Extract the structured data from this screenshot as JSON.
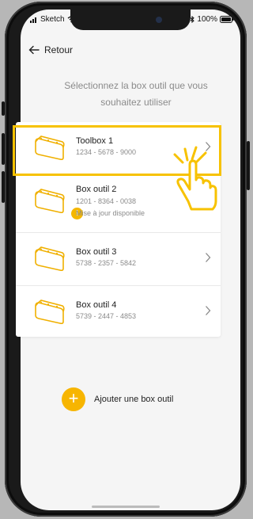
{
  "status": {
    "carrier": "Sketch",
    "battery": "100%"
  },
  "nav": {
    "back_label": "Retour"
  },
  "intro_text": "Sélectionnez la box outil que vous souhaitez utiliser",
  "boxes": [
    {
      "title": "Toolbox 1",
      "code": "1234 - 5678 - 9000",
      "update": ""
    },
    {
      "title": "Box outil 2",
      "code": "1201 - 8364 - 0038",
      "update": "Mise à jour disponible"
    },
    {
      "title": "Box outil 3",
      "code": "5738 - 2357 - 5842",
      "update": ""
    },
    {
      "title": "Box outil 4",
      "code": "5739 - 2447 - 4853",
      "update": ""
    }
  ],
  "add_label": "Ajouter une box outil",
  "colors": {
    "accent": "#f7b500",
    "highlight": "#f7c200"
  }
}
